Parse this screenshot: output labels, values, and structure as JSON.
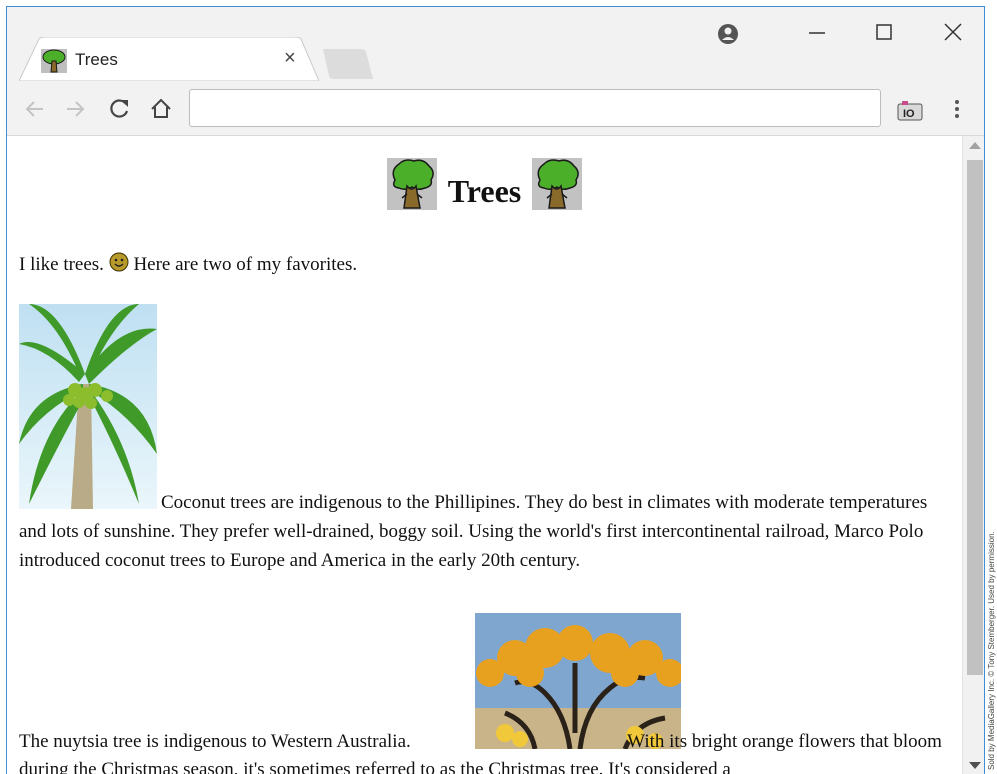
{
  "browser": {
    "tab_title": "Trees",
    "tab_close": "×",
    "address_value": ""
  },
  "page": {
    "heading": "Trees",
    "intro_before": "I like trees. ",
    "intro_after": " Here are two of my favorites.",
    "coconut_text": "Coconut trees are indigenous to the Phillipines. They do best in climates with moderate temperatures and lots of sunshine. They prefer well-drained, boggy soil. Using the world's first intercontinental railroad, Marco Polo introduced coconut trees to Europe and America in the early 20th century.",
    "nuytsia_before": "The nuytsia tree is indigenous to Western Australia.",
    "nuytsia_after": " With its bright orange flowers that bloom during the Christmas season, it's sometimes referred to as the Christmas tree. It's considered a"
  },
  "credit": "Sold by MediaGallery Inc. © Tony Stemberger. Used by permission.",
  "icons": {
    "tab_favicon": "tree-icon",
    "profile": "account-circle-icon",
    "minimize": "minimize-icon",
    "maximize": "maximize-icon",
    "close": "close-icon",
    "back": "arrow-left-icon",
    "forward": "arrow-right-icon",
    "reload": "reload-icon",
    "home": "home-icon",
    "camera": "camera-icon",
    "menu": "kebab-menu-icon",
    "smiley": "smiley-icon"
  },
  "colors": {
    "window_border": "#3a8fd6",
    "chrome_bg": "#f2f2f2",
    "tree_green": "#4caf2a",
    "scroll_thumb": "#c1c1c1"
  }
}
